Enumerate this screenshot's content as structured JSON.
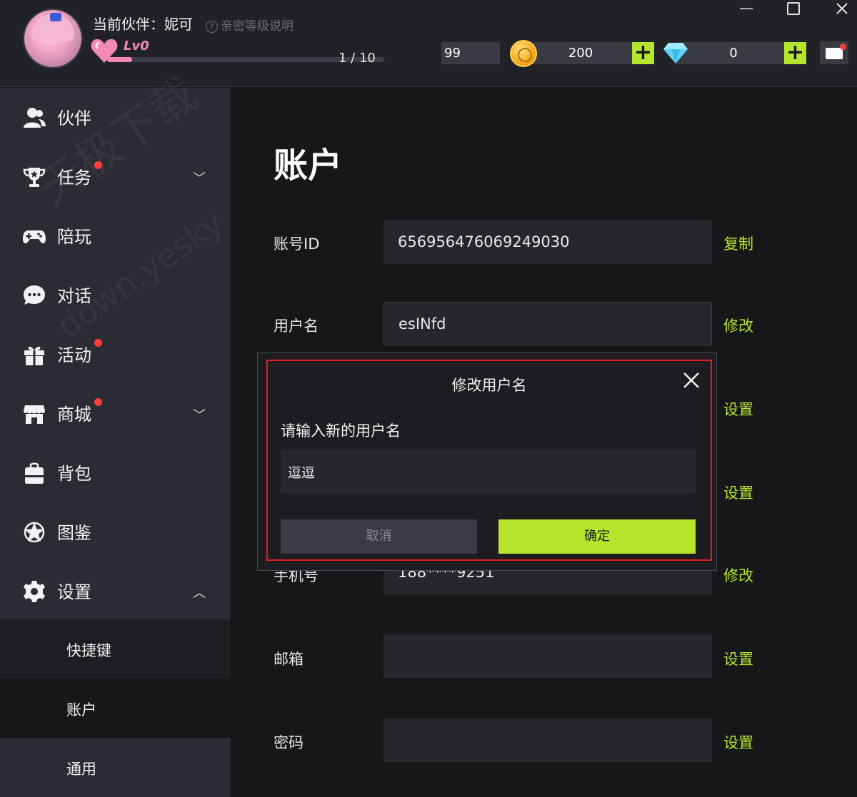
{
  "header": {
    "partner_label": "当前伙伴：妮可",
    "intimacy_help_icon": "?",
    "intimacy_help": "亲密等级说明",
    "level": "Lv0",
    "level_progress": "1 / 10",
    "level_progress_fraction": 0.1,
    "energy_value": "99",
    "coin_value": "200",
    "gem_value": "0",
    "plus_symbol": "+",
    "accent_color": "#b6e62c",
    "heart_color": "#f28ab3"
  },
  "window_controls": {
    "minimize": "—"
  },
  "sidebar": {
    "items": [
      {
        "label": "伙伴",
        "icon": "users-icon"
      },
      {
        "label": "任务",
        "icon": "trophy-icon",
        "badge": true,
        "expandable": true
      },
      {
        "label": "陪玩",
        "icon": "gamepad-icon"
      },
      {
        "label": "对话",
        "icon": "chat-icon"
      },
      {
        "label": "活动",
        "icon": "gift-icon",
        "badge": true
      },
      {
        "label": "商城",
        "icon": "store-icon",
        "badge": true,
        "expandable": true
      },
      {
        "label": "背包",
        "icon": "backpack-icon"
      },
      {
        "label": "图鉴",
        "icon": "star-badge-icon"
      },
      {
        "label": "设置",
        "icon": "gear-icon",
        "expanded": true
      }
    ],
    "sub_items": [
      {
        "label": "快捷键"
      },
      {
        "label": "账户",
        "selected": true
      },
      {
        "label": "通用"
      }
    ],
    "chevron_down": "﹀",
    "chevron_up": "︿"
  },
  "watermark": {
    "line1": "天极下载",
    "line2": "down.yesky"
  },
  "account": {
    "title": "账户",
    "rows": [
      {
        "label": "账号ID",
        "value": "656956476069249030",
        "action": "复制"
      },
      {
        "label": "用户名",
        "value": "esINfd",
        "action": "修改"
      },
      {
        "label": "",
        "value": "",
        "action": "设置"
      },
      {
        "label": "",
        "value": "",
        "action": "设置"
      },
      {
        "label": "手机号",
        "value": "188****9251",
        "action": "修改"
      },
      {
        "label": "邮箱",
        "value": "",
        "action": "设置"
      },
      {
        "label": "密码",
        "value": "",
        "action": "设置"
      }
    ]
  },
  "modal": {
    "title": "修改用户名",
    "prompt": "请输入新的用户名",
    "input_value": "逗逗",
    "cancel_label": "取消",
    "confirm_label": "确定",
    "highlight_color": "#e02020"
  }
}
